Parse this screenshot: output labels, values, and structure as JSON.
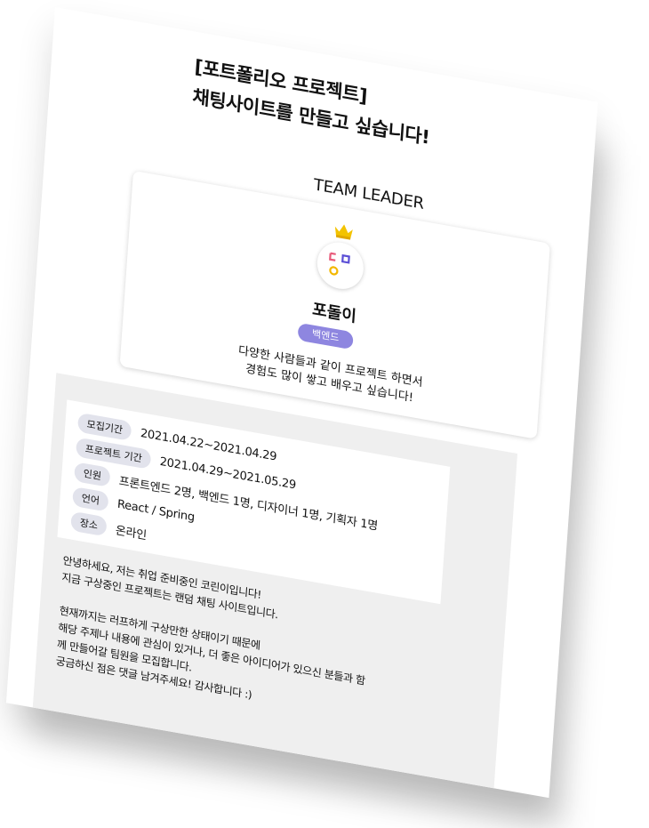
{
  "title_line1": "[포트폴리오 프로젝트]",
  "title_line2": "채팅사이트를 만들고 싶습니다!",
  "leader_label": "TEAM LEADER",
  "leader": {
    "name": "포돌이",
    "role": "백엔드",
    "description": "다양한 사람들과 같이 프로젝트 하면서\n경험도 많이 쌓고 배우고 싶습니다!"
  },
  "info": [
    {
      "label": "모집기간",
      "value": "2021.04.22~2021.04.29"
    },
    {
      "label": "프로젝트 기간",
      "value": "2021.04.29~2021.05.29"
    },
    {
      "label": "인원",
      "value": "프론트엔드 2명, 백엔드 1명, 디자이너 1명, 기획자 1명"
    },
    {
      "label": "언어",
      "value": "React / Spring"
    },
    {
      "label": "장소",
      "value": "온라인"
    }
  ],
  "body": "안녕하세요, 저는 취업 준비중인 코린이입니다!\n지금 구상중인 프로젝트는 랜덤 채팅 사이트입니다.\n\n현재까지는 러프하게 구상만한 상태이기 때문에\n해당 주제나 내용에 관심이 있거나, 더 좋은 아이디어가 있으신 분들과 함\n께 만들어갈 팀원을 모집합니다.\n궁금하신 점은 댓글 남겨주세요! 감사합니다 :)",
  "colors": {
    "badge": "#8e86e0",
    "label_bg": "#e2e3ec",
    "detail_bg": "#efefef"
  },
  "icons": {
    "crown": "crown-icon",
    "avatar": "avatar-face-icon"
  }
}
